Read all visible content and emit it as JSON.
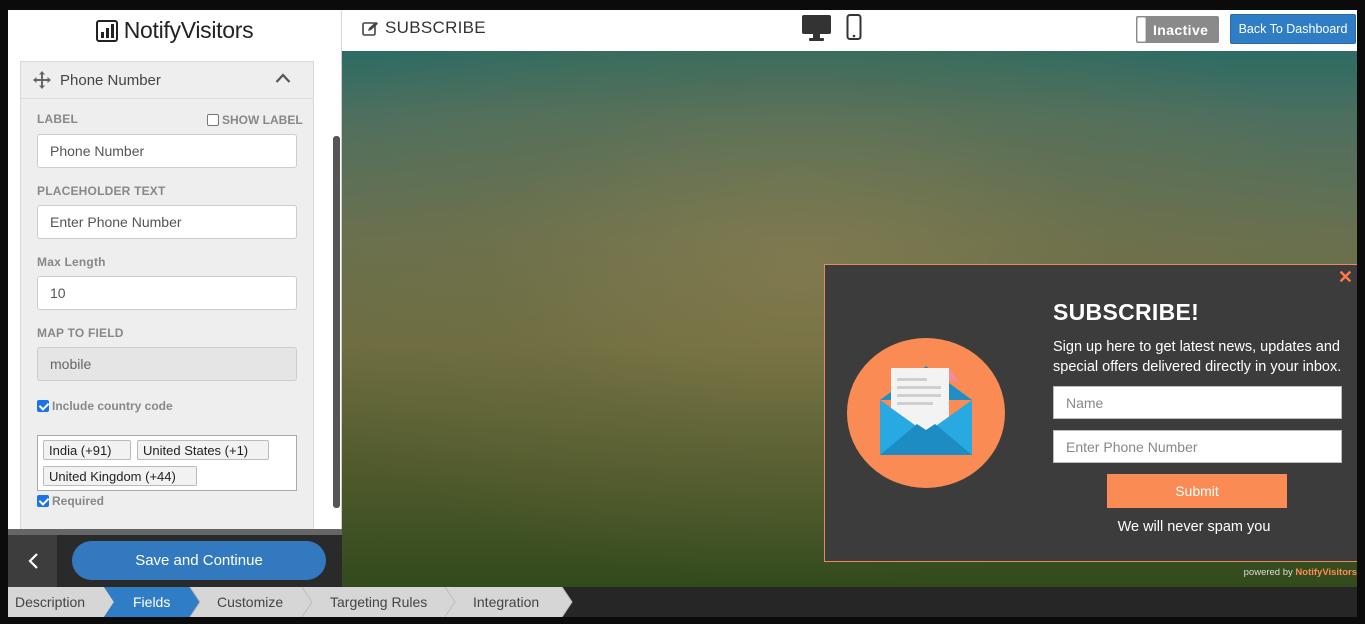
{
  "header": {
    "brand": "NotifyVisitors",
    "title": "SUBSCRIBE",
    "status": "Inactive",
    "back_button": "Back To Dashboard"
  },
  "field_editor": {
    "field_name": "Phone Number",
    "label_caption": "LABEL",
    "show_label_caption": "SHOW LABEL",
    "show_label_checked": false,
    "label_value": "Phone Number",
    "placeholder_caption": "PLACEHOLDER TEXT",
    "placeholder_value": "Enter Phone Number",
    "maxlength_caption": "Max Length",
    "maxlength_value": "10",
    "map_caption": "MAP TO FIELD",
    "map_value": "mobile",
    "country_code_caption": "Include country code",
    "country_code_checked": true,
    "countries": [
      "India (+91)",
      "United States (+1)",
      "United Kingdom (+44)"
    ],
    "required_caption": "Required",
    "required_checked": true
  },
  "footer": {
    "save_button": "Save and Continue"
  },
  "popup": {
    "heading": "SUBSCRIBE!",
    "description": "Sign up here to get latest news, updates and special offers delivered directly in your inbox.",
    "name_placeholder": "Name",
    "phone_placeholder": "Enter Phone Number",
    "submit": "Submit",
    "note": "We will never spam you",
    "powered_prefix": "powered by",
    "powered_brand": "NotifyVisitors"
  },
  "wizard": {
    "steps": [
      "Description",
      "Fields",
      "Customize",
      "Targeting Rules",
      "Integration"
    ],
    "active_step": "Fields"
  },
  "colors": {
    "accent_blue": "#2f7ec5",
    "popup_orange": "#fb8b54",
    "popup_bg": "#3c3c3c",
    "wizard_active": "#2f7ec5",
    "wizard_inactive": "#d6d6d6"
  }
}
